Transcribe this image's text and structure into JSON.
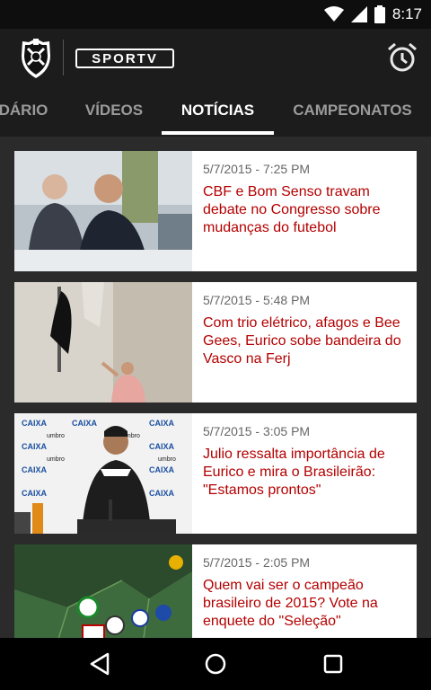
{
  "status_bar": {
    "time": "8:17",
    "icons": [
      "wifi-icon",
      "signal-icon",
      "battery-icon"
    ]
  },
  "app_bar": {
    "brand": "SPORTV",
    "club_logo": "vasco-crest",
    "action_icon": "alarm-clock-icon"
  },
  "tabs": [
    {
      "label": "DÁRIO",
      "active": false
    },
    {
      "label": "VÍDEOS",
      "active": false
    },
    {
      "label": "NOTÍCIAS",
      "active": true
    },
    {
      "label": "CAMPEONATOS",
      "active": false
    }
  ],
  "news": [
    {
      "date": "5/7/2015 - 7:25 PM",
      "title": "CBF e Bom Senso travam debate no Congresso sobre mudanças do futebol"
    },
    {
      "date": "5/7/2015 - 5:48 PM",
      "title": "Com trio elétrico, afagos e Bee Gees, Eurico sobe bandeira do Vasco na Ferj"
    },
    {
      "date": "5/7/2015 - 3:05 PM",
      "title": "Julio ressalta importância de Eurico e mira o Brasileirão: \"Estamos prontos\""
    },
    {
      "date": "5/7/2015 - 2:05 PM",
      "title": "Quem vai ser o campeão brasileiro de 2015? Vote na enquete do \"Seleção\""
    }
  ],
  "thumb_text": {
    "sponsor": "CAIXA",
    "maker": "umbro"
  },
  "colors": {
    "title_red": "#b40000",
    "app_bar": "#1c1c1c",
    "background": "#2b2b2b"
  },
  "nav_bar": {
    "icons": [
      "back-icon",
      "home-icon",
      "recents-icon"
    ]
  }
}
